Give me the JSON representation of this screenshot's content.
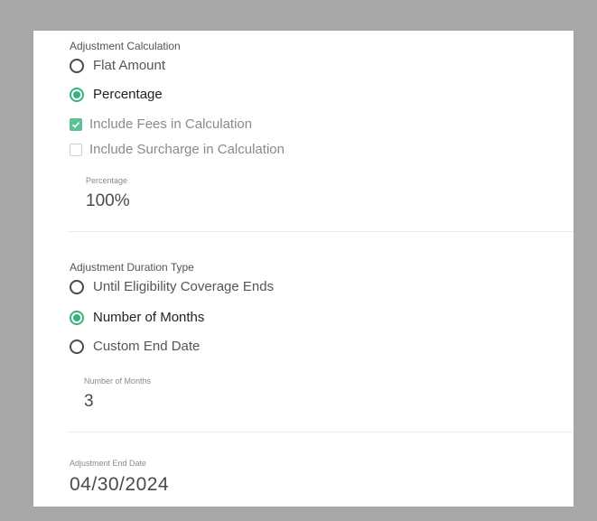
{
  "adjustment_calculation": {
    "label": "Adjustment Calculation",
    "options": [
      {
        "label": "Flat Amount",
        "selected": false
      },
      {
        "label": "Percentage",
        "selected": true
      }
    ],
    "checkboxes": [
      {
        "label": "Include Fees in Calculation",
        "checked": true
      },
      {
        "label": "Include Surcharge in Calculation",
        "checked": false
      }
    ],
    "percentage_field": {
      "label": "Percentage",
      "value": "100%"
    }
  },
  "adjustment_duration": {
    "label": "Adjustment Duration Type",
    "options": [
      {
        "label": "Until Eligibility Coverage Ends",
        "selected": false
      },
      {
        "label": "Number of Months",
        "selected": true
      },
      {
        "label": "Custom End Date",
        "selected": false
      }
    ],
    "months_field": {
      "label": "Number of Months",
      "value": "3"
    }
  },
  "end_date": {
    "label": "Adjustment End Date",
    "value": "04/30/2024"
  },
  "colors": {
    "accent": "#35b37e",
    "checkbox_fill": "#5cc193",
    "background": "#a6a7a9"
  }
}
